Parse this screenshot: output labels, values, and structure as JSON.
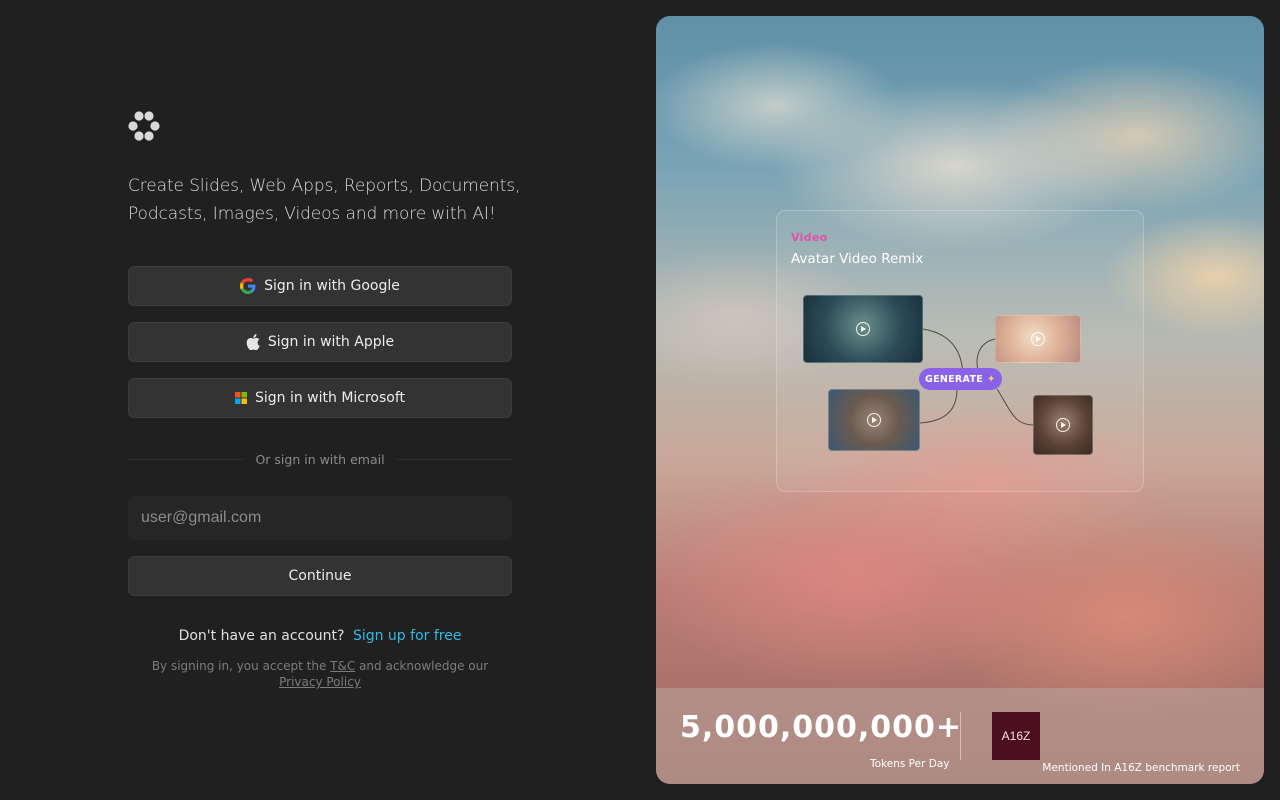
{
  "tagline": "Create Slides, Web Apps, Reports, Documents, Podcasts, Images, Videos and more with AI!",
  "auth": {
    "google_label": "Sign in with Google",
    "apple_label": "Sign in with Apple",
    "microsoft_label": "Sign in with Microsoft",
    "divider_text": "Or sign in with email",
    "email_placeholder": "user@gmail.com",
    "continue_label": "Continue"
  },
  "signup": {
    "prompt": "Don't have an account?",
    "link_label": "Sign up for free"
  },
  "legal": {
    "prefix": "By signing in, you accept the",
    "tc_label": "T&C",
    "middle": "and acknowledge our",
    "privacy_label": "Privacy Policy"
  },
  "hero": {
    "card_kicker": "Video",
    "card_title": "Avatar Video Remix",
    "generate_label": "GENERATE",
    "stat_value": "5,000,000,000+",
    "stat_label": "Tokens Per Day",
    "partner_logo_text": "A16Z",
    "mention_text": "Mentioned In A16Z benchmark report"
  },
  "colors": {
    "background": "#202020",
    "button_bg": "#333333",
    "link": "#33b9e8",
    "generate_pill": "#8a62e8",
    "kicker": "#e052a8"
  },
  "icons": [
    "app-logo-icon",
    "google-icon",
    "apple-icon",
    "microsoft-icon",
    "play-icon",
    "sparkle-icon"
  ]
}
